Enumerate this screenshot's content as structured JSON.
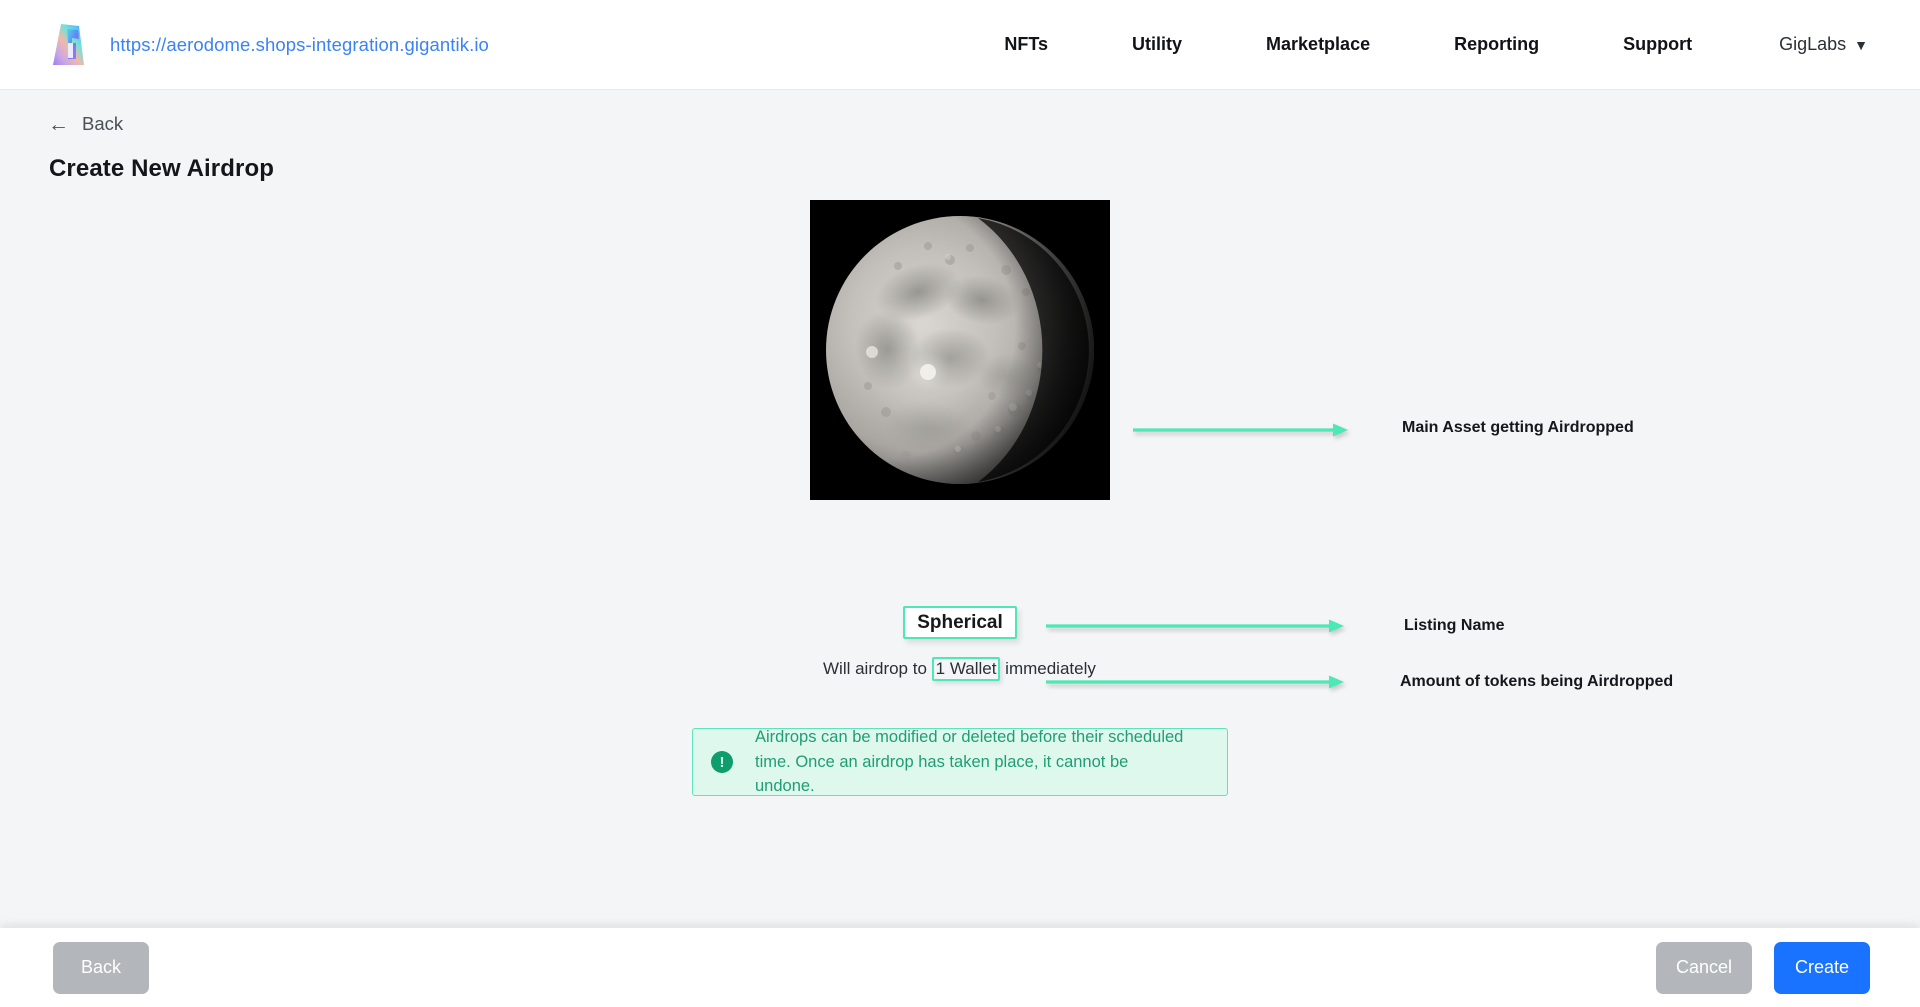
{
  "navbar": {
    "logo_icon": "gigantik-logo-icon",
    "url": "https://aerodome.shops-integration.gigantik.io",
    "links": [
      {
        "label": "NFTs"
      },
      {
        "label": "Utility"
      },
      {
        "label": "Marketplace"
      },
      {
        "label": "Reporting"
      },
      {
        "label": "Support"
      }
    ],
    "account": {
      "label": "GigLabs",
      "caret": "▼"
    }
  },
  "page": {
    "back_icon": "←",
    "back_label": "Back",
    "title": "Create New Airdrop"
  },
  "asset": {
    "image_alt": "moon-nft-image",
    "listing_name": "Spherical",
    "airdrop_prefix": "Will airdrop to",
    "airdrop_amount": "1 Wallet",
    "airdrop_suffix": "immediately"
  },
  "annotations": [
    {
      "label": "Main Asset getting Airdropped"
    },
    {
      "label": "Listing Name"
    },
    {
      "label": "Amount of tokens being Airdropped"
    }
  ],
  "info_banner": {
    "icon": "!",
    "text": "Airdrops can be modified or deleted before their scheduled time. Once an airdrop has taken place, it cannot be undone."
  },
  "footer": {
    "back_label": "Back",
    "cancel_label": "Cancel",
    "create_label": "Create"
  },
  "colors": {
    "accent_blue": "#1a73ff",
    "link_blue": "#3b82f6",
    "annotation_green": "#4de8b4",
    "banner_bg": "#dff8ee",
    "banner_text": "#1f9d74",
    "disabled_gray": "#b3b7bc",
    "page_bg": "#f4f5f7"
  }
}
